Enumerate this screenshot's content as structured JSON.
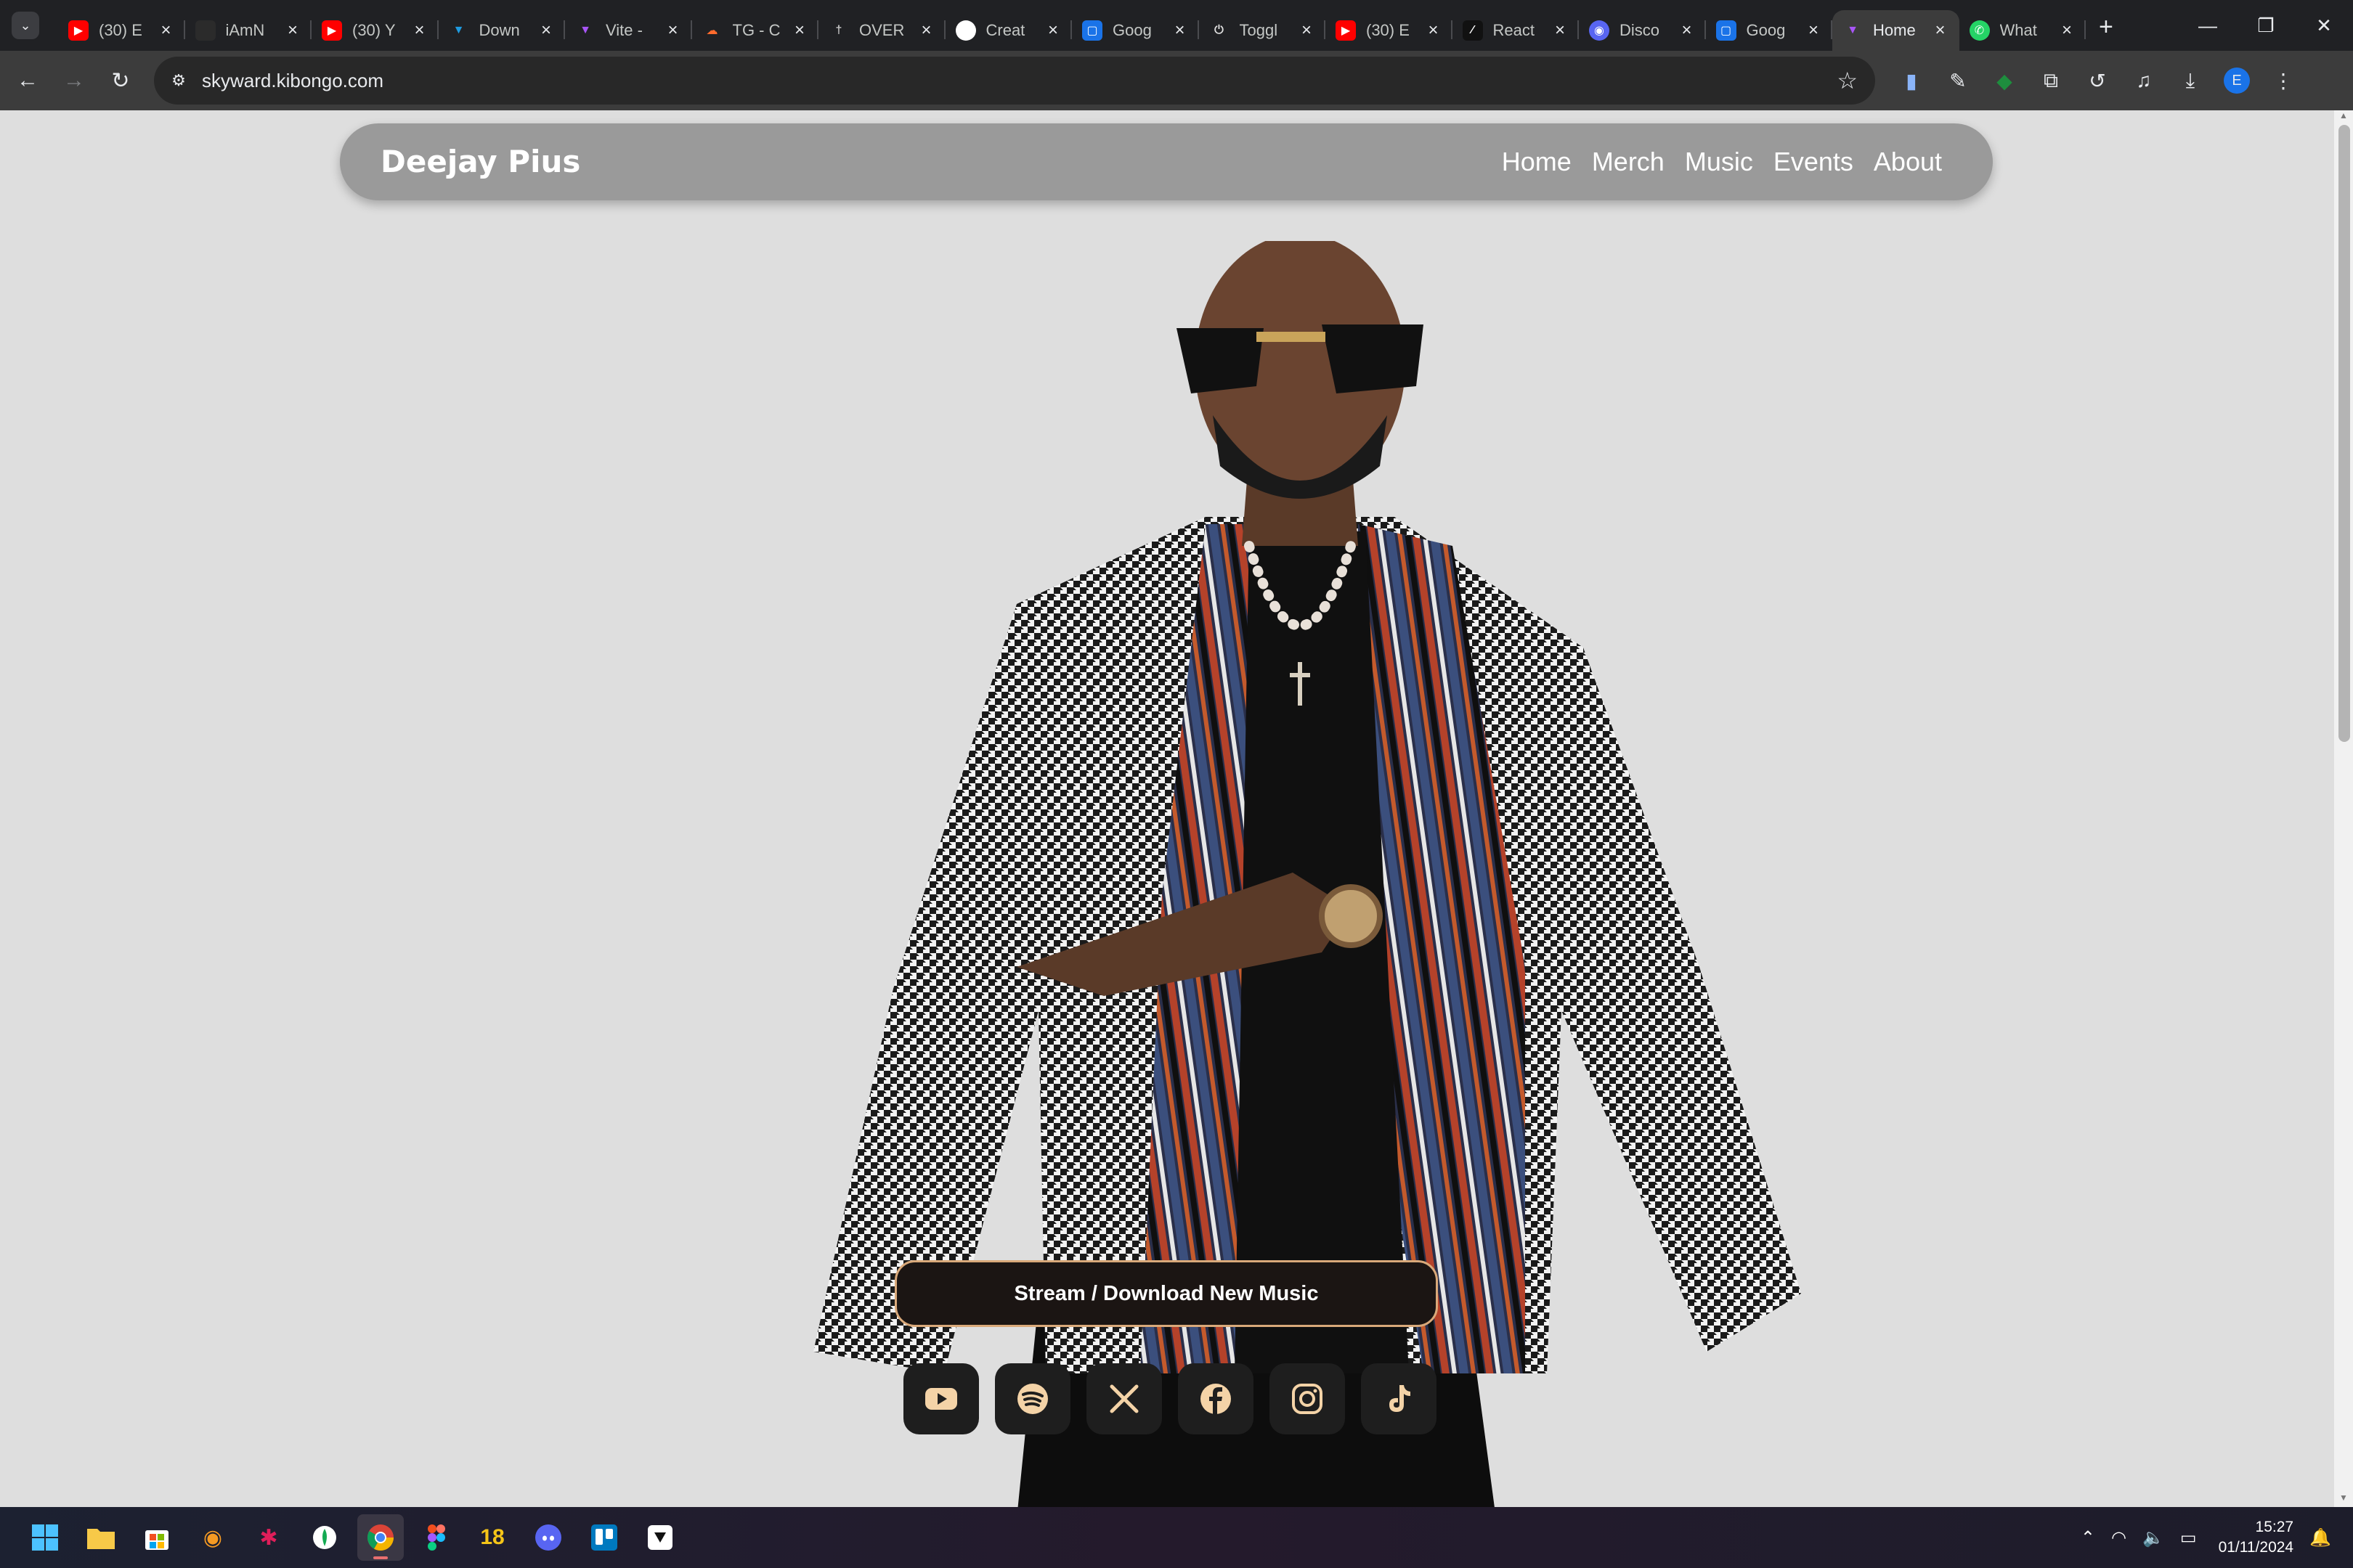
{
  "browser": {
    "tabs": [
      {
        "title": "(30) E",
        "icon": "youtube-icon",
        "color": "#ff0000"
      },
      {
        "title": "iAmN",
        "icon": "github-icon",
        "color": "#2b2b2b"
      },
      {
        "title": "(30) Y",
        "icon": "youtube-icon",
        "color": "#ff0000"
      },
      {
        "title": "Down",
        "icon": "download-app-icon",
        "color": "#1e9be0"
      },
      {
        "title": "Vite -",
        "icon": "vite-icon",
        "color": "#a855f7"
      },
      {
        "title": "TG - C",
        "icon": "cloud-icon",
        "color": "#ff6b2d"
      },
      {
        "title": "OVER",
        "icon": "cross-icon",
        "color": "#c8c8c8"
      },
      {
        "title": "Creat",
        "icon": "github-icon",
        "color": "#ffffff"
      },
      {
        "title": "Goog",
        "icon": "google-classroom-icon",
        "color": "#1a73e8"
      },
      {
        "title": "Toggl",
        "icon": "toggl-icon",
        "color": "#dddddd"
      },
      {
        "title": "(30) E",
        "icon": "youtube-icon",
        "color": "#ff0000"
      },
      {
        "title": "React",
        "icon": "react-icon",
        "color": "#111111"
      },
      {
        "title": "Disco",
        "icon": "discord-icon",
        "color": "#5865f2"
      },
      {
        "title": "Goog",
        "icon": "google-classroom-icon",
        "color": "#1a73e8"
      },
      {
        "title": "Home",
        "icon": "vite-icon",
        "color": "#a855f7",
        "active": true
      },
      {
        "title": "What",
        "icon": "whatsapp-icon",
        "color": "#25d366"
      }
    ],
    "url": "skyward.kibongo.com",
    "profile_initial": "E"
  },
  "site": {
    "brand": "Deejay Pius",
    "nav": [
      "Home",
      "Merch",
      "Music",
      "Events",
      "About"
    ],
    "cta": "Stream / Download New Music",
    "socials": [
      "youtube-icon",
      "spotify-icon",
      "x-icon",
      "facebook-icon",
      "instagram-icon",
      "tiktok-icon"
    ],
    "accent": "#f4d3a7"
  },
  "taskbar": {
    "time": "15:27",
    "date": "01/11/2024"
  }
}
